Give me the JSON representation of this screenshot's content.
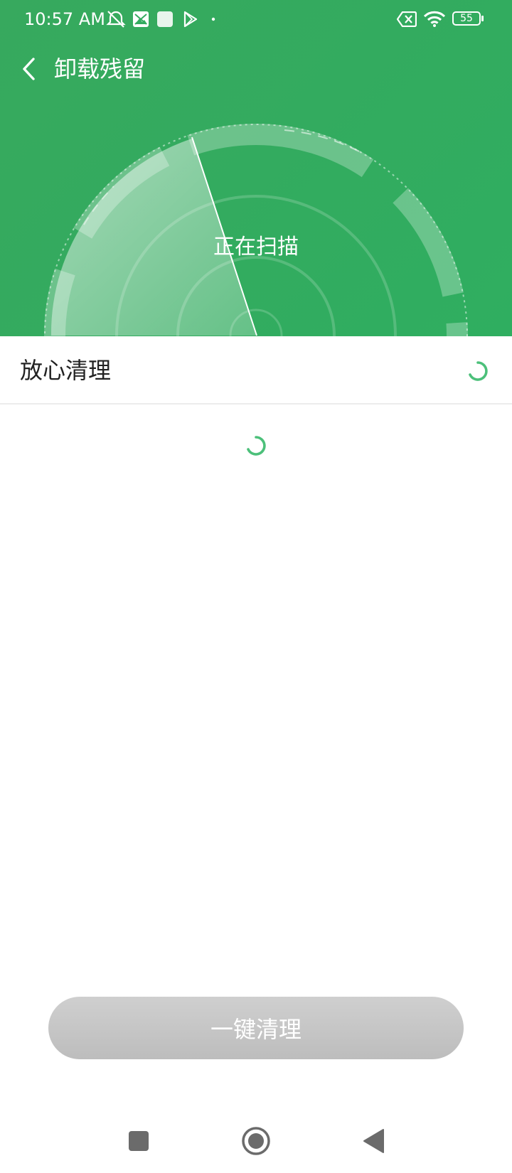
{
  "status_bar": {
    "time": "10:57 AM",
    "battery_level": "55",
    "icons": [
      "alarm-off-icon",
      "photo-app-icon",
      "square-app-icon",
      "play-store-icon",
      "dot-icon",
      "no-sim-icon",
      "wifi-icon",
      "battery-icon"
    ]
  },
  "header": {
    "title": "卸载残留",
    "scan_status": "正在扫描",
    "background_color": "#33ab5f"
  },
  "section": {
    "title": "放心清理"
  },
  "actions": {
    "clean_button_label": "一键清理"
  },
  "colors": {
    "accent": "#33ab5f",
    "spinner": "#4cc07a",
    "button_disabled": "#c6c6c6"
  },
  "navigation_bar": {
    "icons": [
      "recents-icon",
      "home-icon",
      "back-icon"
    ]
  }
}
